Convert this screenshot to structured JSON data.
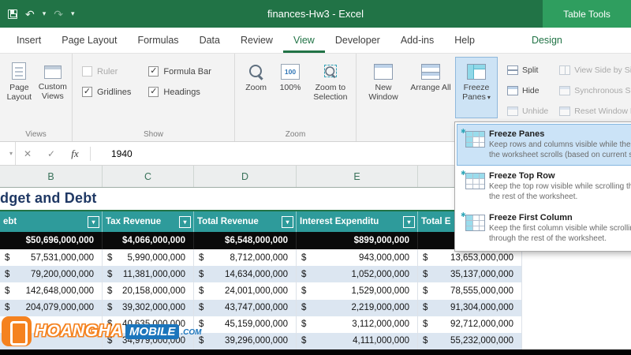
{
  "icons": {
    "caret_down": "▾",
    "check": "✓",
    "close": "✕",
    "undo": "↶",
    "redo": "↷",
    "fx": "fx",
    "snowflake": "✱"
  },
  "colors": {
    "excel_green": "#217346",
    "table_tools_green": "#2f9e5f",
    "table_header_teal": "#2e9b9b",
    "band_blue": "#dce6f1",
    "dark_row": "#0a0a0a",
    "title_navy": "#1f3864",
    "watermark_orange": "#f5821f",
    "watermark_blue": "#1b75bc"
  },
  "titlebar": {
    "title": "finances-Hw3 - Excel",
    "table_tools": "Table Tools"
  },
  "tabs": {
    "items": [
      "Insert",
      "Page Layout",
      "Formulas",
      "Data",
      "Review",
      "View",
      "Developer",
      "Add-ins",
      "Help"
    ],
    "active": "View",
    "contextual": "Design"
  },
  "ribbon": {
    "views": {
      "label": "Views",
      "page_layout": "Page Layout",
      "custom_views": "Custom Views"
    },
    "show": {
      "label": "Show",
      "checkboxes": [
        {
          "label": "Ruler",
          "mark": ""
        },
        {
          "label": "Gridlines",
          "mark": "✓"
        },
        {
          "label": "Formula Bar",
          "mark": "✓"
        },
        {
          "label": "Headings",
          "mark": "✓"
        }
      ]
    },
    "zoom": {
      "label": "Zoom",
      "zoom_btn": "Zoom",
      "pct_btn": "100%",
      "pct_icon_text": "100",
      "zts_btn": "Zoom to Selection"
    },
    "window": {
      "new_window": "New Window",
      "arrange_all": "Arrange All",
      "freeze_panes": "Freeze Panes",
      "split": "Split",
      "hide": "Hide",
      "unhide": "Unhide",
      "view_side": "View Side by Side",
      "sync_scroll": "Synchronous Scrolling",
      "reset_pos": "Reset Window Position"
    }
  },
  "freeze_menu": {
    "items": [
      {
        "title": "Freeze Panes",
        "desc1": "Keep rows and columns visible while the rest of",
        "desc2": "the worksheet scrolls (based on current selection)."
      },
      {
        "title": "Freeze Top Row",
        "desc1": "Keep the top row visible while scrolling through",
        "desc2": "the rest of the worksheet."
      },
      {
        "title": "Freeze First Column",
        "desc1": "Keep the first column visible while scrolling",
        "desc2": "through the rest of the worksheet."
      }
    ]
  },
  "formula_bar": {
    "value": "1940"
  },
  "sheet": {
    "column_headers": [
      "B",
      "C",
      "D",
      "E"
    ],
    "title": "dget and Debt",
    "table": {
      "currency": "$",
      "headers": [
        "ebt",
        "Tax Revenue",
        "Total Revenue",
        "Interest Expenditu",
        "Total E"
      ],
      "dark_row": [
        "$50,696,000,000",
        "$4,066,000,000",
        "$6,548,000,000",
        "$899,000,000"
      ],
      "rows": [
        [
          "57,531,000,000",
          "5,990,000,000",
          "8,712,000,000",
          "943,000,000",
          "13,653,000,000"
        ],
        [
          "79,200,000,000",
          "11,381,000,000",
          "14,634,000,000",
          "1,052,000,000",
          "35,137,000,000"
        ],
        [
          "142,648,000,000",
          "20,158,000,000",
          "24,001,000,000",
          "1,529,000,000",
          "78,555,000,000"
        ],
        [
          "204,079,000,000",
          "39,302,000,000",
          "43,747,000,000",
          "2,219,000,000",
          "91,304,000,000"
        ],
        [
          "",
          "40,635,000,000",
          "45,159,000,000",
          "3,112,000,000",
          "92,712,000,000"
        ],
        [
          "",
          "34,979,000,000",
          "39,296,000,000",
          "4,111,000,000",
          "55,232,000,000"
        ]
      ]
    }
  },
  "watermark": {
    "part1": "HOANGHA",
    "part2": "MOBILE",
    "part3": ".COM"
  }
}
